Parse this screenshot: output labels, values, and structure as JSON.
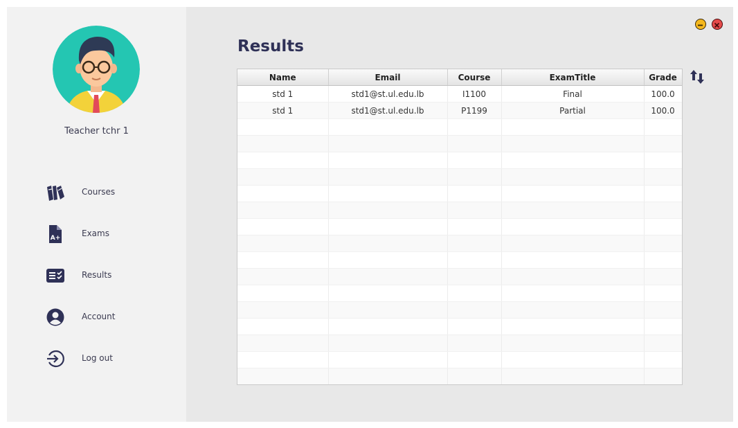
{
  "user": {
    "name": "Teacher tchr 1"
  },
  "nav": [
    {
      "label": "Courses",
      "icon": "books-icon"
    },
    {
      "label": "Exams",
      "icon": "exam-file-icon"
    },
    {
      "label": "Results",
      "icon": "results-list-icon"
    },
    {
      "label": "Account",
      "icon": "account-icon"
    },
    {
      "label": "Log out",
      "icon": "logout-icon"
    }
  ],
  "main": {
    "title": "Results"
  },
  "table": {
    "columns": [
      "Name",
      "Email",
      "Course",
      "ExamTitle",
      "Grade"
    ],
    "rows": [
      [
        "std 1",
        "std1@st.ul.edu.lb",
        "I1100",
        "Final",
        "100.0"
      ],
      [
        "std 1",
        "std1@st.ul.edu.lb",
        "P1199",
        "Partial",
        "100.0"
      ]
    ]
  },
  "colors": {
    "accent": "#2f3157",
    "sidebar_bg": "#f2f2f2",
    "content_bg": "#e8e8e8",
    "minimize": "#f5b81d",
    "close": "#e54b4b"
  }
}
